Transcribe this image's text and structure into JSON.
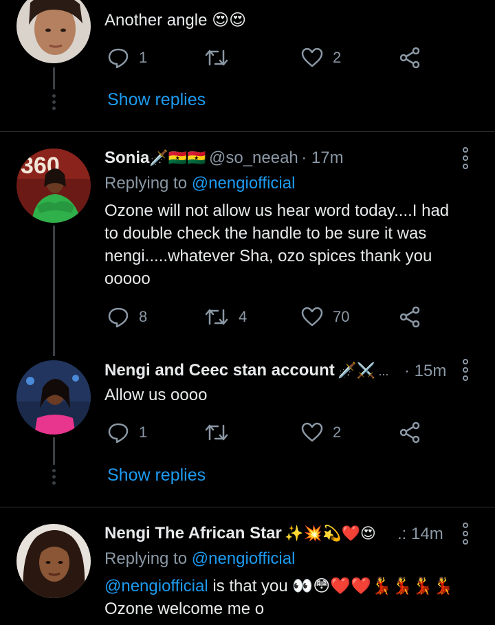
{
  "tweet1": {
    "text": "Another angle 😍😍",
    "replies": "1",
    "retweets": "",
    "likes": "2",
    "show_replies": "Show replies"
  },
  "tweet2": {
    "name": "Sonia",
    "name_emoji": "🗡️🇬🇭🇬🇭",
    "handle": "@so_neeah",
    "time": "· 17m",
    "replying_prefix": "Replying to ",
    "replying_handle": "@nengiofficial",
    "text_lines": [
      "Ozone will not allow us hear word today....I had",
      "to double check the handle to be sure it was",
      "nengi.....whatever Sha, ozo spices thank you",
      "ooooo"
    ],
    "replies": "8",
    "retweets": "4",
    "likes": "70"
  },
  "tweet3": {
    "name": "Nengi and Ceec stan account",
    "name_emoji": "🗡️⚔️",
    "ellipsis": "...",
    "time": "· 15m",
    "text": "Allow us oooo",
    "replies": "1",
    "retweets": "",
    "likes": "2",
    "show_replies": "Show replies"
  },
  "tweet4": {
    "name": "Nengi The African Star",
    "name_emoji": "✨💥💫❤️😍",
    "time": ".: 14m",
    "replying_prefix": "Replying to ",
    "replying_handle": "@nengiofficial",
    "text_mention": "@nengiofficial",
    "text_rest": " is that you 👀😳❤️❤️💃💃💃💃",
    "text_line2": "Ozone welcome me o"
  },
  "colors": {
    "background": "#000000",
    "text": "#e7e9ea",
    "secondary": "#8b98a5",
    "link": "#1d9bf0",
    "divider": "#2f3336"
  },
  "icons": [
    "reply-icon",
    "retweet-icon",
    "like-icon",
    "share-icon",
    "more-options-icon"
  ]
}
